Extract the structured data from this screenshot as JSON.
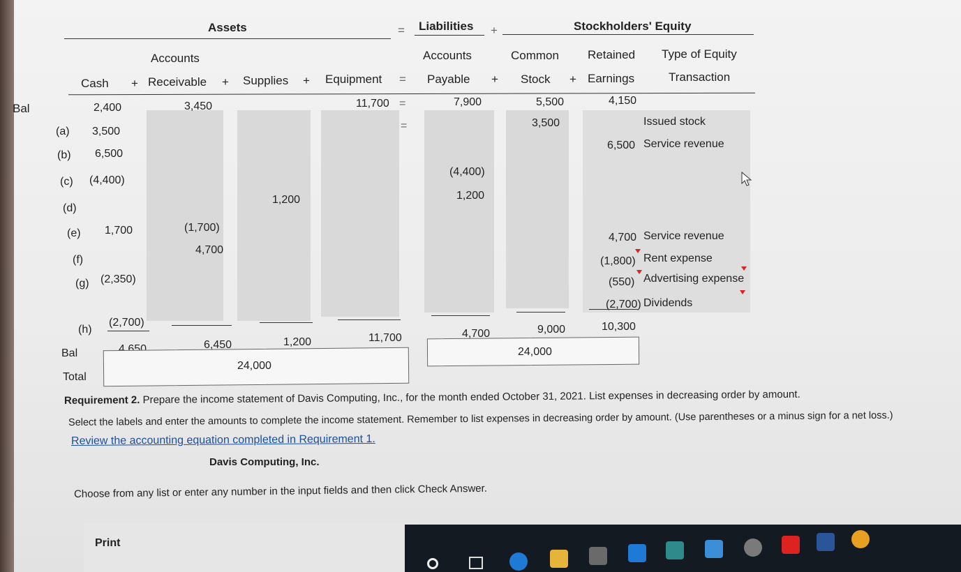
{
  "headers": {
    "assets": "Assets",
    "equals": "=",
    "liabilities": "Liabilities",
    "plus": "+",
    "stockholders_equity": "Stockholders' Equity"
  },
  "columns": {
    "accounts_top": "Accounts",
    "cash": "Cash",
    "plus1": "+",
    "receivable": "Receivable",
    "plus2": "+",
    "supplies": "Supplies",
    "plus3": "+",
    "equipment": "Equipment",
    "equals": "=",
    "accounts_top2": "Accounts",
    "payable": "Payable",
    "plus4": "+",
    "common_top": "Common",
    "stock": "Stock",
    "plus5": "+",
    "retained_top": "Retained",
    "earnings": "Earnings",
    "type_top": "Type of Equity",
    "transaction": "Transaction"
  },
  "rows": [
    {
      "label": "Bal",
      "cash": "2,400",
      "ar": "3,450",
      "supplies": "",
      "equipment": "11,700",
      "eq": "=",
      "ap": "7,900",
      "stock": "5,500",
      "re": "4,150",
      "type": ""
    },
    {
      "label": "(a)",
      "cash": "3,500",
      "ar": "",
      "supplies": "",
      "equipment": "",
      "eq": "=",
      "ap": "",
      "stock": "3,500",
      "re": "",
      "type": "Issued stock"
    },
    {
      "label": "(b)",
      "cash": "6,500",
      "ar": "",
      "supplies": "",
      "equipment": "",
      "eq": "",
      "ap": "",
      "stock": "",
      "re": "6,500",
      "type": "Service revenue"
    },
    {
      "label": "(c)",
      "cash": "(4,400)",
      "ar": "",
      "supplies": "",
      "equipment": "",
      "eq": "",
      "ap": "(4,400)",
      "stock": "",
      "re": "",
      "type": ""
    },
    {
      "label": "(d)",
      "cash": "",
      "ar": "",
      "supplies": "1,200",
      "equipment": "",
      "eq": "",
      "ap": "1,200",
      "stock": "",
      "re": "",
      "type": ""
    },
    {
      "label": "(e)",
      "cash": "1,700",
      "ar": "(1,700)",
      "supplies": "",
      "equipment": "",
      "eq": "",
      "ap": "",
      "stock": "",
      "re": "",
      "type": ""
    },
    {
      "label": "(f)",
      "cash": "",
      "ar": "4,700",
      "supplies": "",
      "equipment": "",
      "eq": "",
      "ap": "",
      "stock": "",
      "re": "4,700",
      "type": "Service revenue"
    },
    {
      "label": "",
      "cash": "",
      "ar": "",
      "supplies": "",
      "equipment": "",
      "eq": "",
      "ap": "",
      "stock": "",
      "re": "(1,800)",
      "type": "Rent expense"
    },
    {
      "label": "(g)",
      "cash": "(2,350)",
      "ar": "",
      "supplies": "",
      "equipment": "",
      "eq": "",
      "ap": "",
      "stock": "",
      "re": "(550)",
      "type": "Advertising expense"
    },
    {
      "label": "",
      "cash": "",
      "ar": "",
      "supplies": "",
      "equipment": "",
      "eq": "",
      "ap": "",
      "stock": "",
      "re": "(2,700)",
      "type": "Dividends"
    },
    {
      "label": "(h)",
      "cash": "(2,700)",
      "ar": "",
      "supplies": "",
      "equipment": "",
      "eq": "",
      "ap": "",
      "stock": "",
      "re": "",
      "type": ""
    }
  ],
  "balance": {
    "label": "Bal",
    "cash": "4,650",
    "ar": "6,450",
    "supplies": "1,200",
    "equipment": "11,700",
    "ap": "4,700",
    "stock": "9,000",
    "re": "10,300"
  },
  "totals": {
    "label": "Total",
    "assets_total": "24,000",
    "liab_equity_total": "24,000"
  },
  "requirement": {
    "title": "Requirement 2.",
    "text_line1": " Prepare the income statement of Davis Computing, Inc., for the month ended October 31, 2021. List expenses in decreasing order by amount.",
    "prev_line": "List expenses in decreasing order by amount.",
    "text_line2": "Select the labels and enter the amounts to complete the income statement. Remember to list expenses in decreasing order by amount. (Use parentheses or a minus sign for a net loss.)",
    "link": "Review the accounting equation completed in Requirement 1.",
    "company": "Davis Computing, Inc.",
    "instruction": "Choose from any list or enter any number in the input fields and then click Check Answer.",
    "print": "Print"
  },
  "colors": {
    "taskbar": "#141a22",
    "link": "#1a4fa3",
    "cell": "#d4d4d4"
  }
}
